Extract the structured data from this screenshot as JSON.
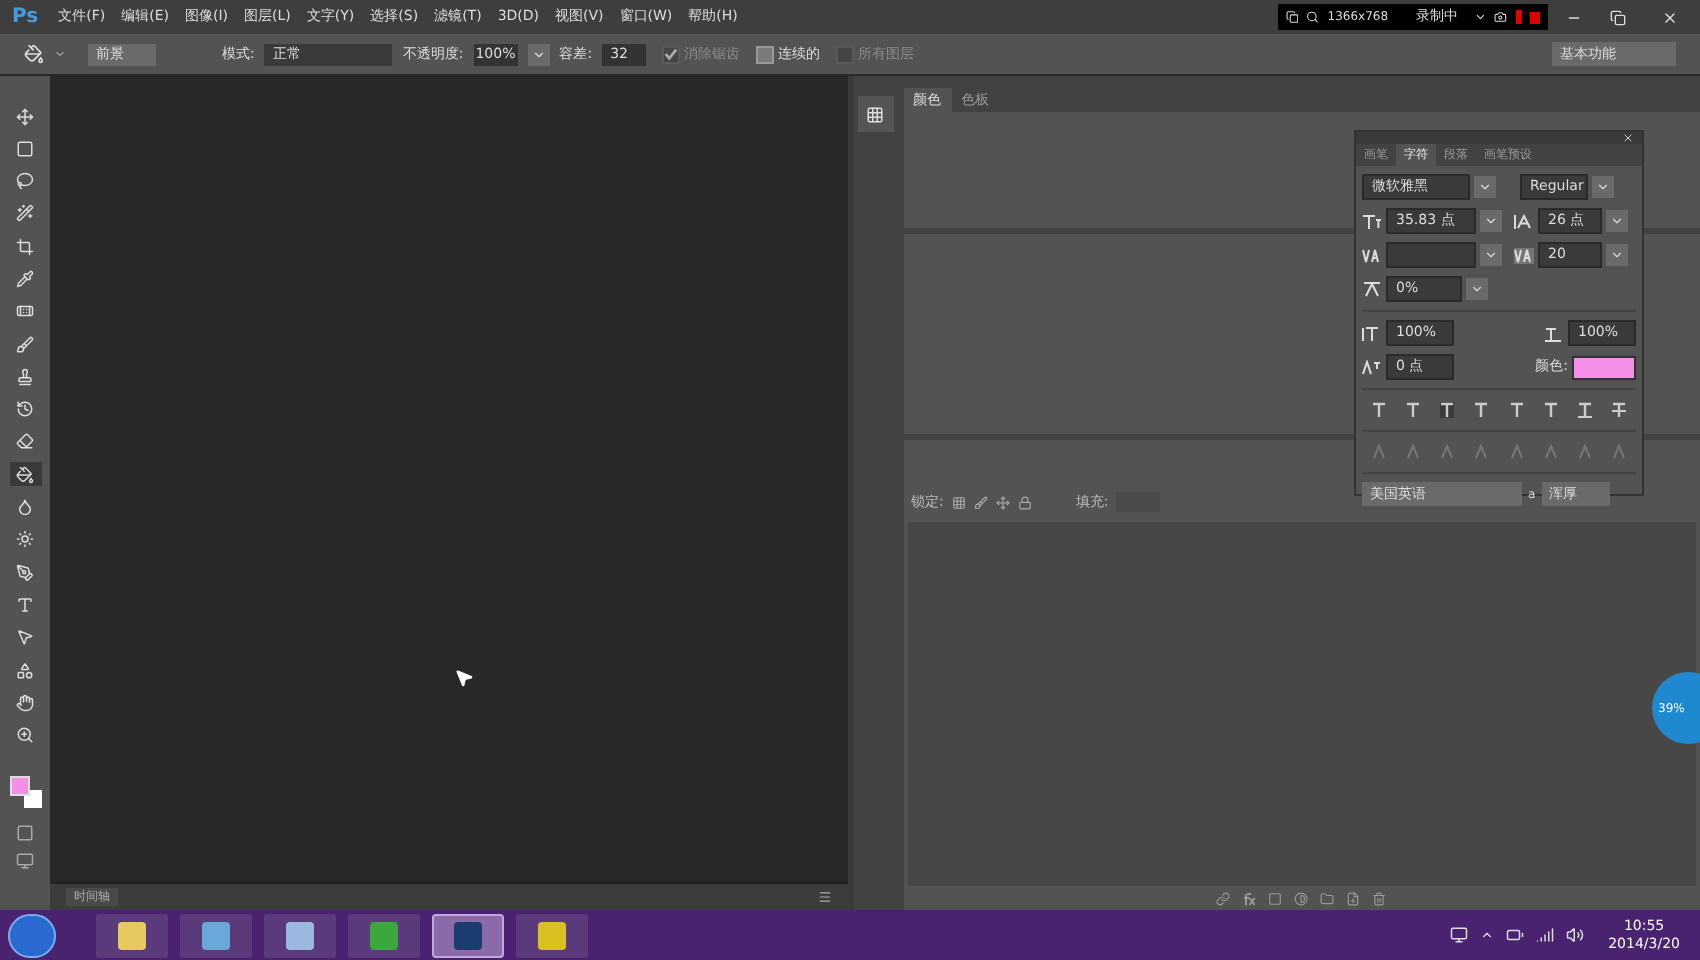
{
  "app_logo": "Ps",
  "menu": [
    "文件(F)",
    "编辑(E)",
    "图像(I)",
    "图层(L)",
    "文字(Y)",
    "选择(S)",
    "滤镜(T)",
    "3D(D)",
    "视图(V)",
    "窗口(W)",
    "帮助(H)"
  ],
  "recorder": {
    "resolution": "1366x768",
    "status": "录制中"
  },
  "options_bar": {
    "fill_source": "前景",
    "mode_label": "模式:",
    "mode": "正常",
    "opacity_label": "不透明度:",
    "opacity": "100%",
    "tolerance_label": "容差:",
    "tolerance": "32",
    "checkboxes": [
      {
        "label": "消除锯齿",
        "checked": true,
        "disabled": true
      },
      {
        "label": "连续的",
        "checked": false,
        "disabled": false
      },
      {
        "label": "所有图层",
        "checked": false,
        "disabled": true
      }
    ],
    "workspace": "基本功能"
  },
  "tools": [
    {
      "selected": false
    },
    {
      "selected": false
    },
    {
      "selected": false
    },
    {
      "selected": false
    },
    {
      "selected": false
    },
    {
      "selected": false
    },
    {
      "selected": false
    },
    {
      "selected": false
    },
    {
      "selected": false
    },
    {
      "selected": false
    },
    {
      "selected": false
    },
    {
      "selected": true
    },
    {
      "selected": false
    },
    {
      "selected": false
    },
    {
      "selected": false
    },
    {
      "selected": false
    },
    {
      "selected": false
    },
    {
      "selected": false
    },
    {
      "selected": false
    },
    {
      "selected": false
    }
  ],
  "color_panel": {
    "tabs": [
      {
        "label": "颜色",
        "selected": true
      },
      {
        "label": "色板",
        "selected": false
      }
    ]
  },
  "character_panel": {
    "tabs": [
      {
        "label": "画笔",
        "selected": false
      },
      {
        "label": "字符",
        "selected": true
      },
      {
        "label": "段落",
        "selected": false
      },
      {
        "label": "画笔预设",
        "selected": false
      }
    ],
    "font_family": "微软雅黑",
    "font_style": "Regular",
    "font_size": "35.83 点",
    "leading": "26 点",
    "tracking": "20",
    "proportional_spacing": "0%",
    "vertical_scale": "100%",
    "horizontal_scale": "100%",
    "baseline_shift": "0 点",
    "color_label": "颜色:",
    "language": "美国英语",
    "antialias_label": "a",
    "antialias": "浑厚"
  },
  "layers_panel": {
    "lock_label": "锁定:",
    "fill_label": "填充:"
  },
  "timeline": {
    "label": "时间轴"
  },
  "overlay_badge": "39%",
  "taskbar": {
    "apps": [
      {
        "selected": false
      },
      {
        "selected": false
      },
      {
        "selected": false
      },
      {
        "selected": false
      },
      {
        "selected": true
      },
      {
        "selected": false
      }
    ],
    "time": "10:55",
    "date": "2014/3/20"
  }
}
